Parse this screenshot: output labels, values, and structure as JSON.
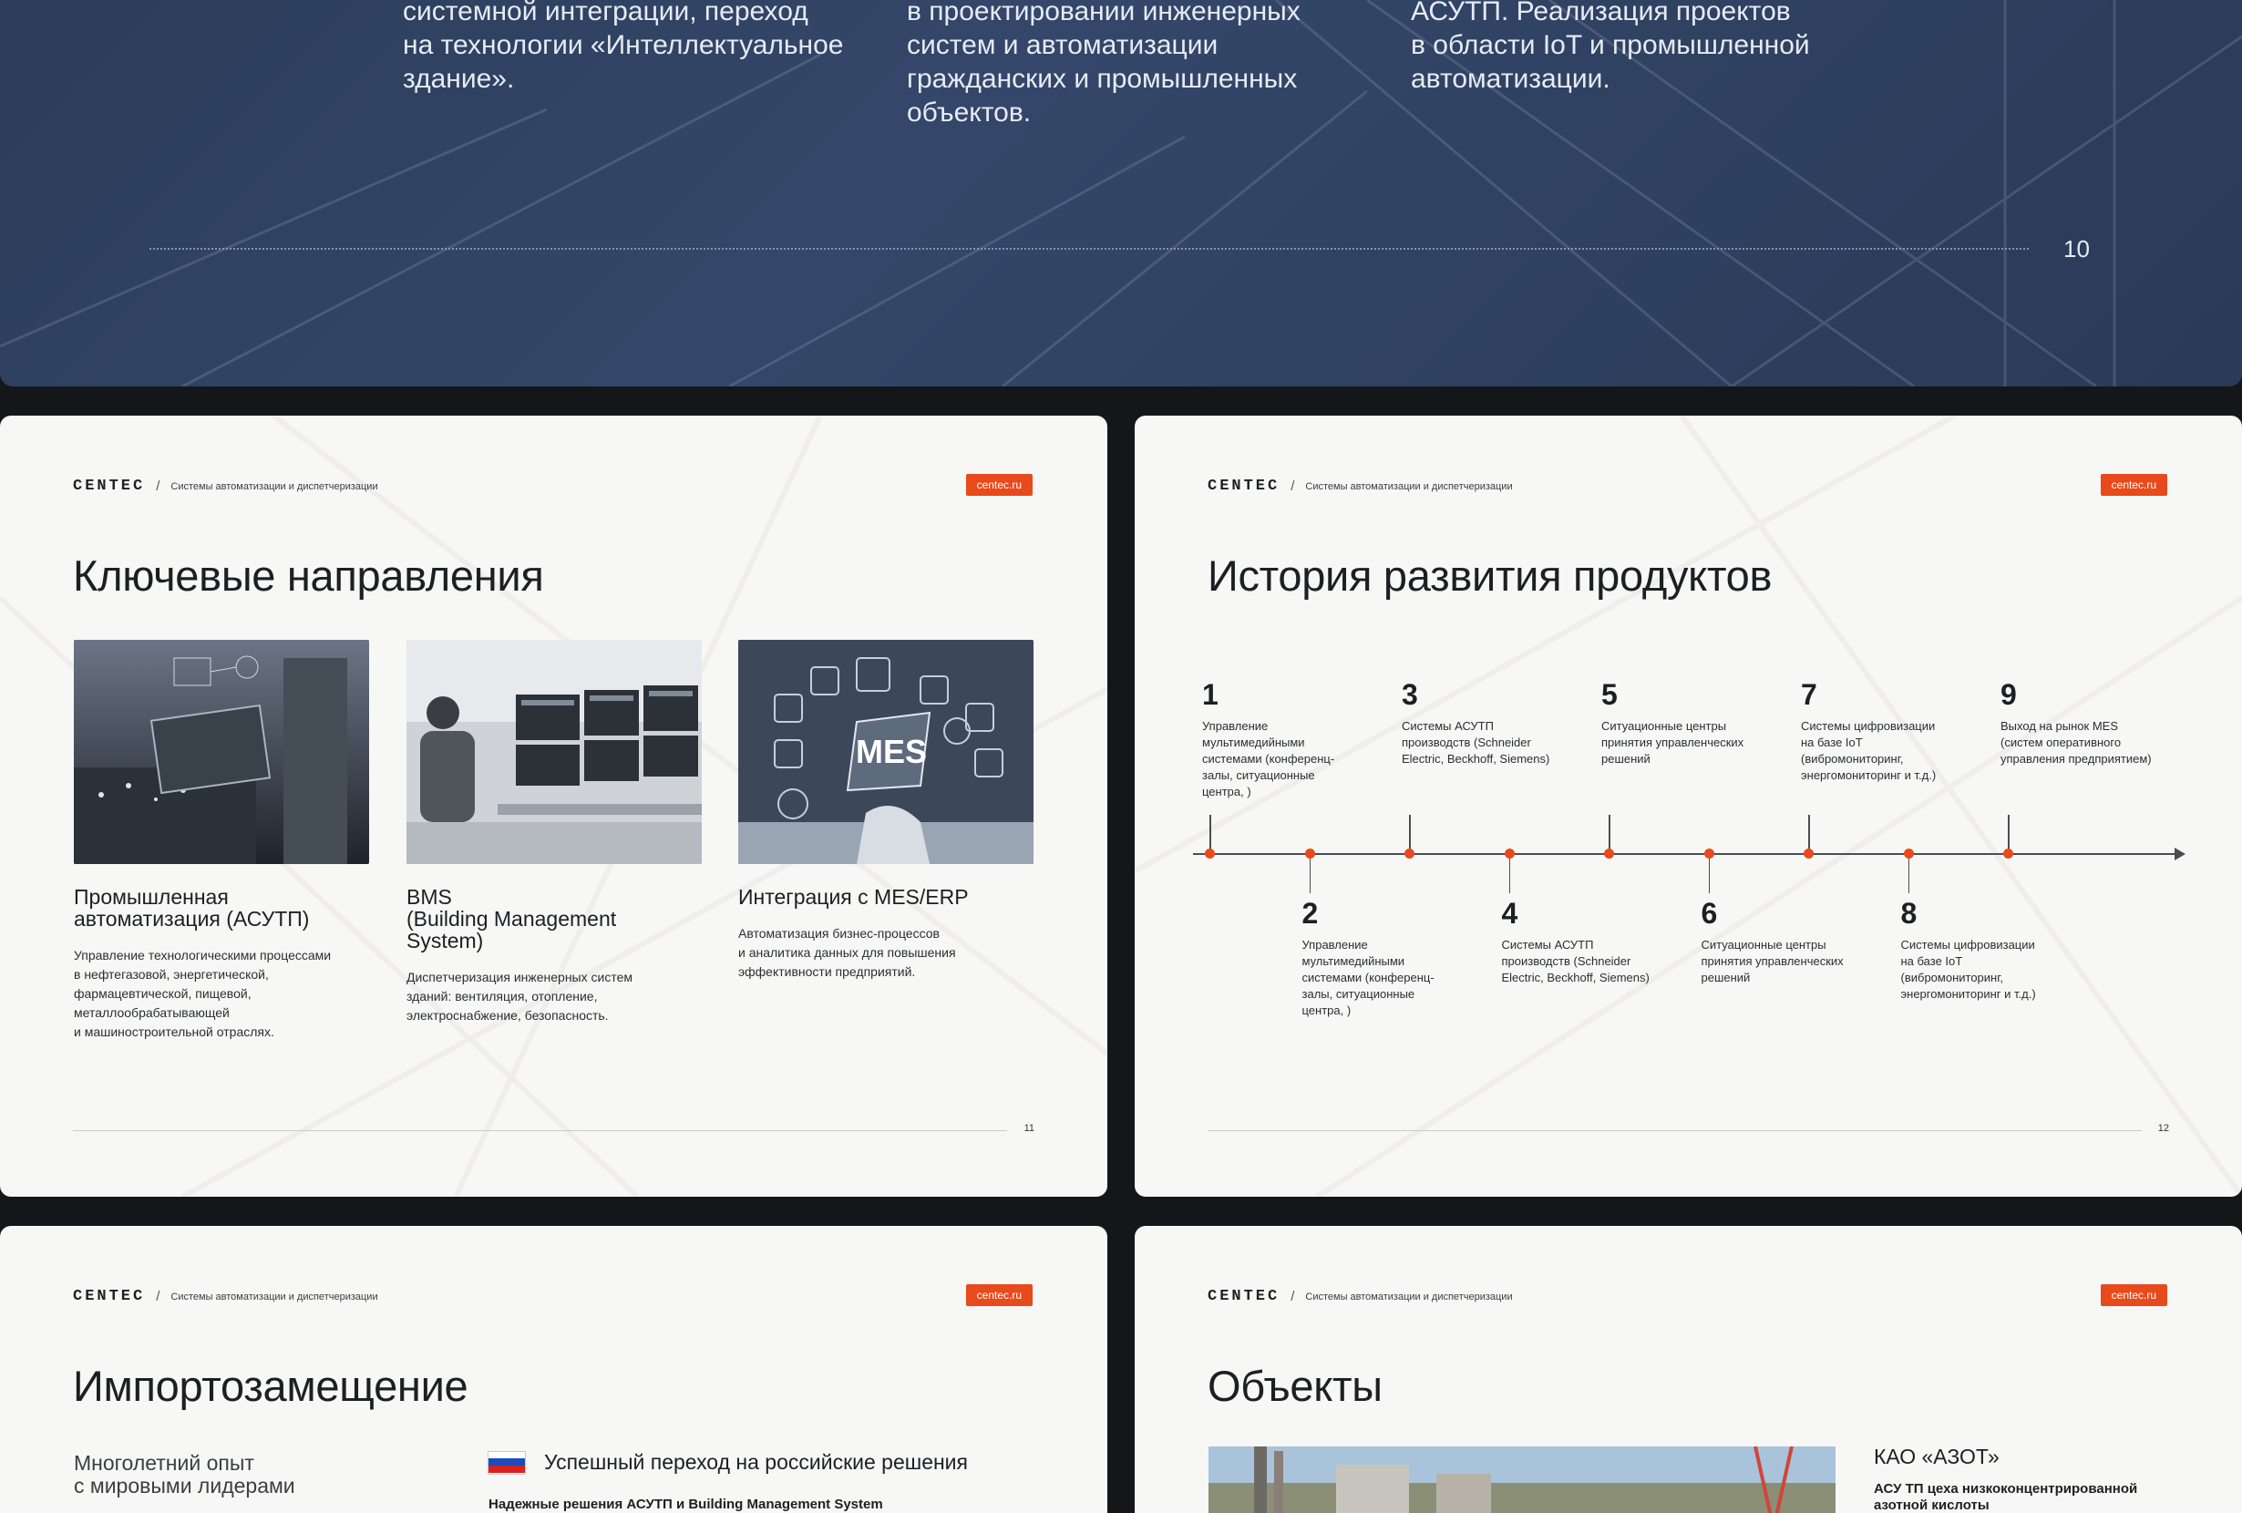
{
  "top_slide": {
    "columns": [
      "системной интеграции, переход\nна технологии «Интеллектуальное\nздание».",
      "в проектировании инженерных\nсистем и автоматизации\nгражданских и промышленных\nобъектов.",
      "АСУТП. Реализация проектов\nв области IoT и промышленной\nавтоматизации."
    ],
    "page_number": "10"
  },
  "brand": {
    "logo": "CENTEC",
    "tagline": "Системы автоматизации и диспетчеризации",
    "site": "centec.ru",
    "accent_color": "#e84a1b"
  },
  "slide11": {
    "title": "Ключевые направления",
    "page_number": "11",
    "cards": [
      {
        "title": "Промышленная\nавтоматизация (АСУТП)",
        "desc": "Управление технологическими процессами\nв нефтегазовой, энергетической,\nфармацевтической, пищевой,\nметаллообрабатывающей\nи машиностроительной отраслях.",
        "image_label": ""
      },
      {
        "title": "BMS\n(Building Management\nSystem)",
        "desc": "Диспетчеризация инженерных систем\nзданий: вентиляция, отопление,\nэлектроснабжение, безопасность.",
        "image_label": ""
      },
      {
        "title": "Интеграция с MES/ERP",
        "desc": "Автоматизация бизнес-процессов\nи аналитика данных для повышения\nэффективности предприятий.",
        "image_label": "MES"
      }
    ]
  },
  "slide12": {
    "title": "История развития продуктов",
    "page_number": "12",
    "items": [
      {
        "num": "1",
        "text": "Управление\nмультимедийными\nсистемами (конференц-\nзалы, ситуационные\nцентра, )",
        "pos": "top"
      },
      {
        "num": "2",
        "text": "Управление\nмультимедийными\nсистемами (конференц-\nзалы, ситуационные\nцентра, )",
        "pos": "bottom"
      },
      {
        "num": "3",
        "text": "Системы АСУТП\nпроизводств (Schneider\nElectric, Beckhoff, Siemens)",
        "pos": "top"
      },
      {
        "num": "4",
        "text": "Системы АСУТП\nпроизводств (Schneider\nElectric, Beckhoff, Siemens)",
        "pos": "bottom"
      },
      {
        "num": "5",
        "text": "Ситуационные центры\nпринятия управленческих\nрешений",
        "pos": "top"
      },
      {
        "num": "6",
        "text": "Ситуационные центры\nпринятия управленческих\nрешений",
        "pos": "bottom"
      },
      {
        "num": "7",
        "text": "Системы цифровизации\nна базе IoT\n(вибромониторинг,\nэнергомониторинг и т.д.)",
        "pos": "top"
      },
      {
        "num": "8",
        "text": "Системы цифровизации\nна базе IoT\n(вибромониторинг,\nэнергомониторинг и т.д.)",
        "pos": "bottom"
      },
      {
        "num": "9",
        "text": "Выход на рынок MES\n(систем оперативного\nуправления предприятием)",
        "pos": "top"
      }
    ]
  },
  "slide13": {
    "title": "Импортозамещение",
    "left_text": "Многолетний опыт\nс мировыми лидерами",
    "right_heading": "Успешный переход на российские решения",
    "right_sub": "Надежные решения АСУТП и Building Management System"
  },
  "slide14": {
    "title": "Объекты",
    "object_name": "КАО «АЗОТ»",
    "object_desc": "АСУ ТП цеха низкоконцентрированной\nазотной кислоты"
  }
}
